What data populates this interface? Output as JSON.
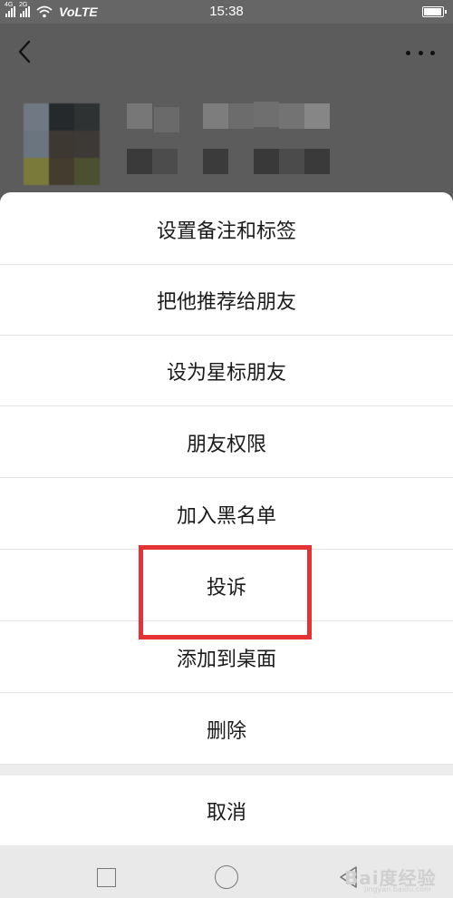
{
  "status_bar": {
    "network_1": "4G",
    "network_2": "2G",
    "volte": "VoLTE",
    "time": "15:38",
    "battery_level": 0.95
  },
  "header": {
    "back_icon": "chevron-left-icon",
    "more_icon": "more-horizontal-icon"
  },
  "action_sheet": {
    "items": [
      {
        "label": "设置备注和标签"
      },
      {
        "label": "把他推荐给朋友"
      },
      {
        "label": "设为星标朋友"
      },
      {
        "label": "朋友权限"
      },
      {
        "label": "加入黑名单"
      },
      {
        "label": "投诉"
      },
      {
        "label": "添加到桌面"
      },
      {
        "label": "删除"
      }
    ],
    "cancel_label": "取消"
  },
  "highlight": {
    "color": "#e53234",
    "target": "投诉"
  },
  "nav_bar": {
    "icons": [
      "recent-apps-icon",
      "home-icon",
      "back-icon"
    ]
  },
  "watermark": {
    "text": "Bai度经验",
    "subtext": "jingyan.baidu.com"
  }
}
